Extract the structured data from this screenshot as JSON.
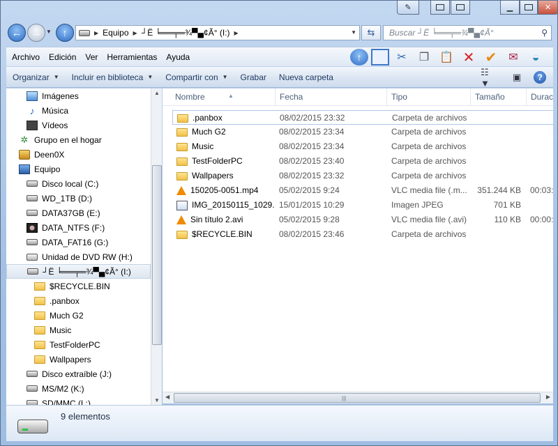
{
  "window": {
    "address_crumbs": [
      "Equipo",
      "┘Ë ╘══╤═¾▀▄¢Ã° (I:)"
    ],
    "search_placeholder": "Buscar ┘Ë ╘══╤═¾▀▄¢Ã°"
  },
  "menu": [
    {
      "id": "archivo",
      "label": "Archivo"
    },
    {
      "id": "edicion",
      "label": "Edición"
    },
    {
      "id": "ver",
      "label": "Ver"
    },
    {
      "id": "herramientas",
      "label": "Herramientas"
    },
    {
      "id": "ayuda",
      "label": "Ayuda"
    }
  ],
  "command_bar": {
    "organizar": "Organizar",
    "incluir": "Incluir en biblioteca",
    "compartir": "Compartir con",
    "grabar": "Grabar",
    "nueva_carpeta": "Nueva carpeta"
  },
  "nav_pane": [
    {
      "id": "imagenes",
      "label": "Imágenes",
      "icon": "pictures-icon",
      "indent": 1
    },
    {
      "id": "musica",
      "label": "Música",
      "icon": "music-icon",
      "indent": 1
    },
    {
      "id": "videos",
      "label": "Vídeos",
      "icon": "videos-icon",
      "indent": 1
    },
    {
      "id": "grupo-hogar",
      "label": "Grupo en el hogar",
      "icon": "homegroup-icon",
      "indent": 0
    },
    {
      "id": "deen0x",
      "label": "Deen0X",
      "icon": "user-folder-icon",
      "indent": 0
    },
    {
      "id": "equipo",
      "label": "Equipo",
      "icon": "computer-icon",
      "indent": 0
    },
    {
      "id": "disco-c",
      "label": "Disco local (C:)",
      "icon": "hard-drive-icon",
      "indent": 1
    },
    {
      "id": "wd-d",
      "label": "WD_1TB (D:)",
      "icon": "hard-drive-icon",
      "indent": 1
    },
    {
      "id": "data37-e",
      "label": "DATA37GB (E:)",
      "icon": "hard-drive-icon",
      "indent": 1
    },
    {
      "id": "ntfs-f",
      "label": "DATA_NTFS (F:)",
      "icon": "avatar-drive-icon",
      "indent": 1
    },
    {
      "id": "fat16-g",
      "label": "DATA_FAT16 (G:)",
      "icon": "hard-drive-icon",
      "indent": 1
    },
    {
      "id": "dvd-h",
      "label": "Unidad de DVD RW (H:)",
      "icon": "dvd-drive-icon",
      "indent": 1
    },
    {
      "id": "drive-i",
      "label": "┘Ë ╘══╤═¾▀▄¢Ã° (I:)",
      "icon": "removable-drive-icon",
      "indent": 1,
      "selected": true
    },
    {
      "id": "recycle",
      "label": "$RECYCLE.BIN",
      "icon": "folder-icon",
      "indent": 2
    },
    {
      "id": "panbox",
      "label": ".panbox",
      "icon": "folder-icon",
      "indent": 2
    },
    {
      "id": "muchg2",
      "label": "Much G2",
      "icon": "folder-icon",
      "indent": 2
    },
    {
      "id": "music",
      "label": "Music",
      "icon": "folder-icon",
      "indent": 2
    },
    {
      "id": "testfolder",
      "label": "TestFolderPC",
      "icon": "folder-icon",
      "indent": 2
    },
    {
      "id": "wallpapers",
      "label": "Wallpapers",
      "icon": "folder-icon",
      "indent": 2
    },
    {
      "id": "disco-j",
      "label": "Disco extraíble (J:)",
      "icon": "removable-drive-icon",
      "indent": 1
    },
    {
      "id": "ms-k",
      "label": "MS/M2 (K:)",
      "icon": "removable-drive-icon",
      "indent": 1
    },
    {
      "id": "sd-l",
      "label": "SD/MMC (L:)",
      "icon": "removable-drive-icon",
      "indent": 1
    }
  ],
  "columns": {
    "nombre": "Nombre",
    "fecha": "Fecha",
    "tipo": "Tipo",
    "tamano": "Tamaño",
    "duracion": "Duración"
  },
  "files": [
    {
      "name": ".panbox",
      "date": "08/02/2015 23:32",
      "type": "Carpeta de archivos",
      "size": "",
      "duration": "",
      "icon": "folder-icon"
    },
    {
      "name": "Much G2",
      "date": "08/02/2015 23:34",
      "type": "Carpeta de archivos",
      "size": "",
      "duration": "",
      "icon": "folder-icon"
    },
    {
      "name": "Music",
      "date": "08/02/2015 23:34",
      "type": "Carpeta de archivos",
      "size": "",
      "duration": "",
      "icon": "folder-icon"
    },
    {
      "name": "TestFolderPC",
      "date": "08/02/2015 23:40",
      "type": "Carpeta de archivos",
      "size": "",
      "duration": "",
      "icon": "folder-icon"
    },
    {
      "name": "Wallpapers",
      "date": "08/02/2015 23:32",
      "type": "Carpeta de archivos",
      "size": "",
      "duration": "",
      "icon": "folder-icon"
    },
    {
      "name": "150205-0051.mp4",
      "date": "05/02/2015 9:24",
      "type": "VLC media file (.m...",
      "size": "351.244 KB",
      "duration": "00:03:",
      "icon": "vlc-icon"
    },
    {
      "name": "IMG_20150115_1029...",
      "date": "15/01/2015 10:29",
      "type": "Imagen JPEG",
      "size": "701 KB",
      "duration": "",
      "icon": "image-file-icon"
    },
    {
      "name": "Sin título 2.avi",
      "date": "05/02/2015 9:28",
      "type": "VLC media file (.avi)",
      "size": "110 KB",
      "duration": "00:00:",
      "icon": "vlc-icon"
    },
    {
      "name": "$RECYCLE.BIN",
      "date": "08/02/2015 23:46",
      "type": "Carpeta de archivos",
      "size": "",
      "duration": "",
      "icon": "folder-icon"
    }
  ],
  "status": {
    "count": "9 elementos"
  }
}
